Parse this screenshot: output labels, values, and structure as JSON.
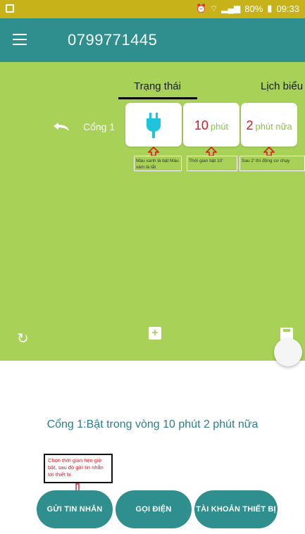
{
  "status_bar": {
    "battery": "80%",
    "time": "09:33"
  },
  "app_bar": {
    "title": "0799771445"
  },
  "tabs": [
    {
      "label": "Trạng thái"
    },
    {
      "label": "Lịch biểu"
    }
  ],
  "gate": {
    "label": "Cổng 1",
    "duration": {
      "value": "10",
      "unit": "phút"
    },
    "remaining": {
      "value": "2",
      "unit": "phút nữa"
    }
  },
  "notes": [
    "Màu xanh là bật Màu xám là tắt",
    "Thời gian bật 10'",
    "Sau 2' thì động cơ chạy"
  ],
  "summary": "Cổng 1:Bật trong vòng 10 phút 2 phút nữa",
  "hint": "Chọn thời gian hẹn giờ bật, sau đó gửi tin nhắn tới thiết bị",
  "buttons": {
    "send_sms": "GỬI TIN NHẮN",
    "call": "GỌI ĐIỆN",
    "device_account": "TÀI KHOẢN THIẾT BỊ"
  },
  "colors": {
    "accent": "#2f8e8e",
    "green_panel": "#a7d257",
    "plug": "#1ec3dd",
    "annotation_red": "#e0161e"
  }
}
